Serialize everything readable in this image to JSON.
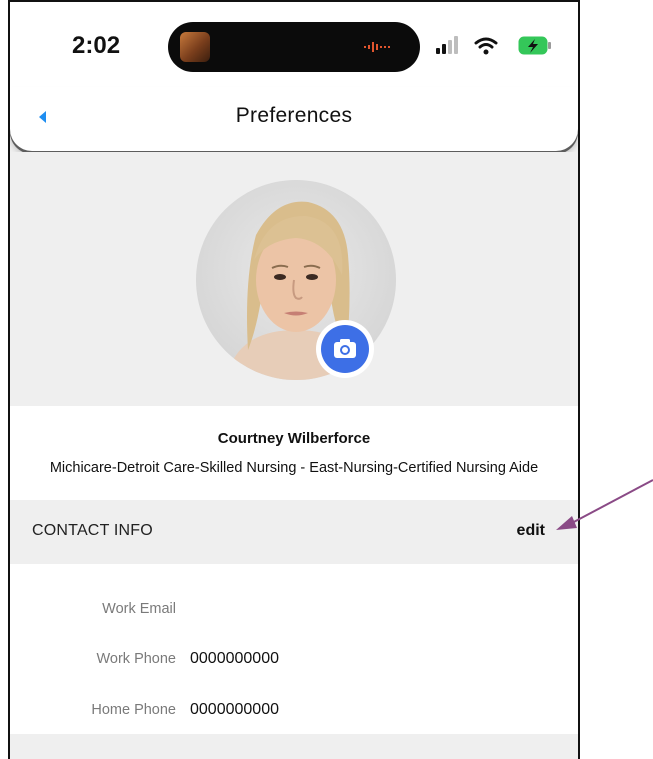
{
  "status_bar": {
    "time": "2:02",
    "battery_color": "#34c759"
  },
  "header": {
    "title": "Preferences",
    "back_icon": "chevron-left-icon"
  },
  "profile": {
    "camera_icon": "camera-icon",
    "name": "Courtney Wilberforce",
    "organization": "Michicare-Detroit Care-Skilled Nursing - East-Nursing-Certified Nursing Aide"
  },
  "contact": {
    "section_title": "CONTACT INFO",
    "edit_label": "edit",
    "rows": [
      {
        "label": "Work Email",
        "value": ""
      },
      {
        "label": "Work Phone",
        "value": "0000000000"
      },
      {
        "label": "Home Phone",
        "value": "0000000000"
      }
    ]
  },
  "colors": {
    "accent": "#3d6fe6",
    "nav_back": "#1f8ef1",
    "annotation_arrow": "#8a4a86"
  }
}
